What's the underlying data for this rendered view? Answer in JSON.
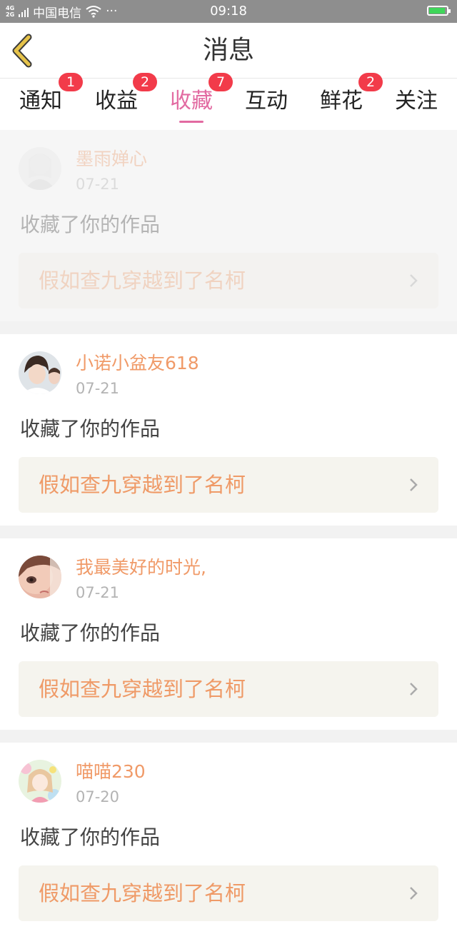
{
  "status_bar": {
    "network_top": "4G",
    "network_bottom": "2G",
    "carrier": "中国电信",
    "more": "···",
    "time": "09:18",
    "battery_level": 0.9,
    "battery_color": "#3fd65a"
  },
  "header": {
    "title": "消息",
    "back_icon": "chevron-left-icon",
    "accent_color": "#e6c34a"
  },
  "tabs": [
    {
      "label": "通知",
      "badge": "1",
      "active": false
    },
    {
      "label": "收益",
      "badge": "2",
      "active": false
    },
    {
      "label": "收藏",
      "badge": "7",
      "active": true
    },
    {
      "label": "互动",
      "badge": "",
      "active": false
    },
    {
      "label": "鲜花",
      "badge": "2",
      "active": false
    },
    {
      "label": "关注",
      "badge": "",
      "active": false
    }
  ],
  "active_tab_color": "#e26aa1",
  "messages": [
    {
      "user": "墨雨婵心",
      "date": "07-21",
      "action": "收藏了你的作品",
      "work": "假如查九穿越到了名柯",
      "faded": true
    },
    {
      "user": "小诺小盆友618",
      "date": "07-21",
      "action": "收藏了你的作品",
      "work": "假如查九穿越到了名柯",
      "faded": false
    },
    {
      "user": "我最美好的时光,",
      "date": "07-21",
      "action": "收藏了你的作品",
      "work": "假如查九穿越到了名柯",
      "faded": false
    },
    {
      "user": "喵喵230",
      "date": "07-20",
      "action": "收藏了你的作品",
      "work": "假如查九穿越到了名柯",
      "faded": false
    }
  ]
}
